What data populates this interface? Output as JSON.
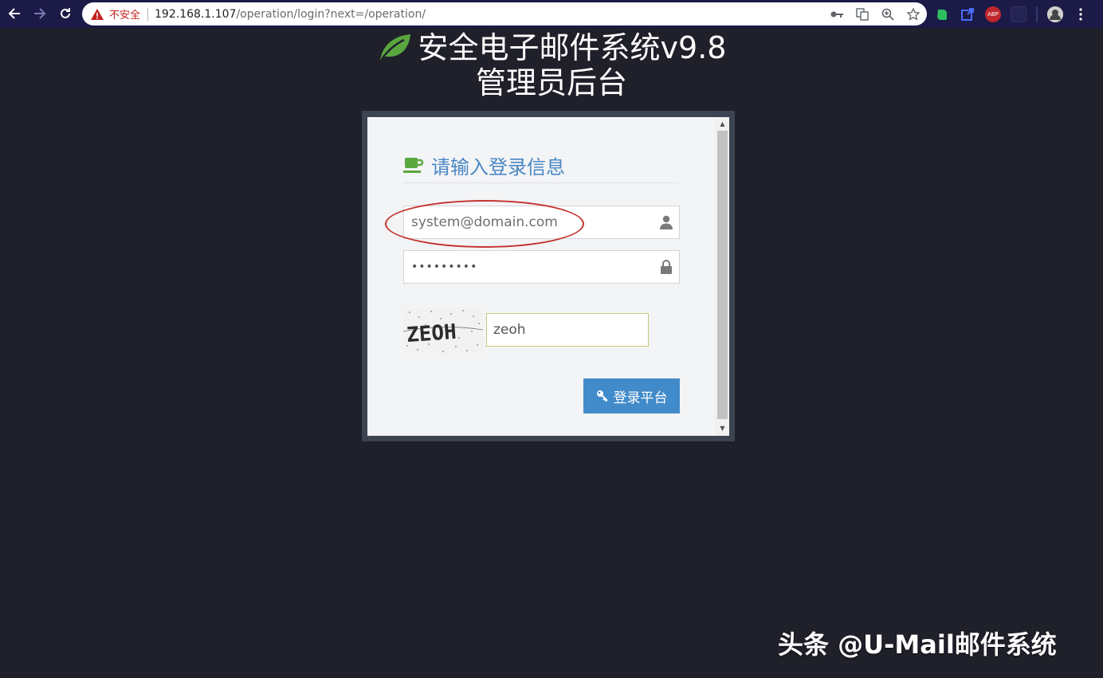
{
  "browser": {
    "security_label": "不安全",
    "url_host": "192.168.1.107",
    "url_path": "/operation/login?next=/operation/",
    "ext_abp_label": "ABP"
  },
  "page": {
    "title_line1": "安全电子邮件系统v9.8",
    "title_line2": "管理员后台",
    "heading": "请输入登录信息",
    "username_value": "system@domain.com",
    "password_dots": "•••••••••",
    "captcha_text": "ZEOH",
    "captcha_value": "zeoh",
    "login_button": "登录平台"
  },
  "watermark": "头条 @U-Mail邮件系统",
  "colors": {
    "page_bg": "#1f202a",
    "chrome_bg": "#1c1a46",
    "accent_blue": "#428bca",
    "heading_blue": "#4a87c4",
    "leaf_green": "#5aa63f"
  }
}
